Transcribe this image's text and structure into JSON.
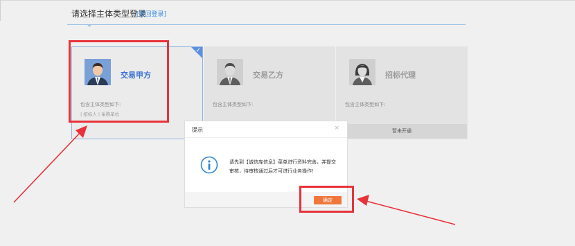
{
  "header": {
    "title": "请选择主体类型登录",
    "back_link": "[返回登录]"
  },
  "cards": [
    {
      "name": "交易甲方",
      "description": "包含主体类型如下:",
      "types": "| 招标人 | 采购单位",
      "footer": "",
      "selected": true,
      "avatar_icon": "male-user-avatar-icon"
    },
    {
      "name": "交易乙方",
      "description": "包含主体类型如下:",
      "types": "",
      "footer": "",
      "selected": false,
      "avatar_icon": "male-user-gray-avatar-icon"
    },
    {
      "name": "招标代理",
      "description": "包含主体类型如下:",
      "types": "",
      "footer": "暂未开通",
      "selected": false,
      "avatar_icon": "female-user-gray-avatar-icon"
    }
  ],
  "dialog": {
    "title": "提示",
    "close_label": "×",
    "icon": "info-icon",
    "message": "请先到【诚信库信息】菜单进行资料完善，并提交审核，待审核通过后才可进行业务操作!",
    "ok_label": "确定"
  },
  "colors": {
    "accent_blue": "#3a6fd6",
    "ok_button": "#f0763c",
    "annotation_red": "#e8323a"
  }
}
